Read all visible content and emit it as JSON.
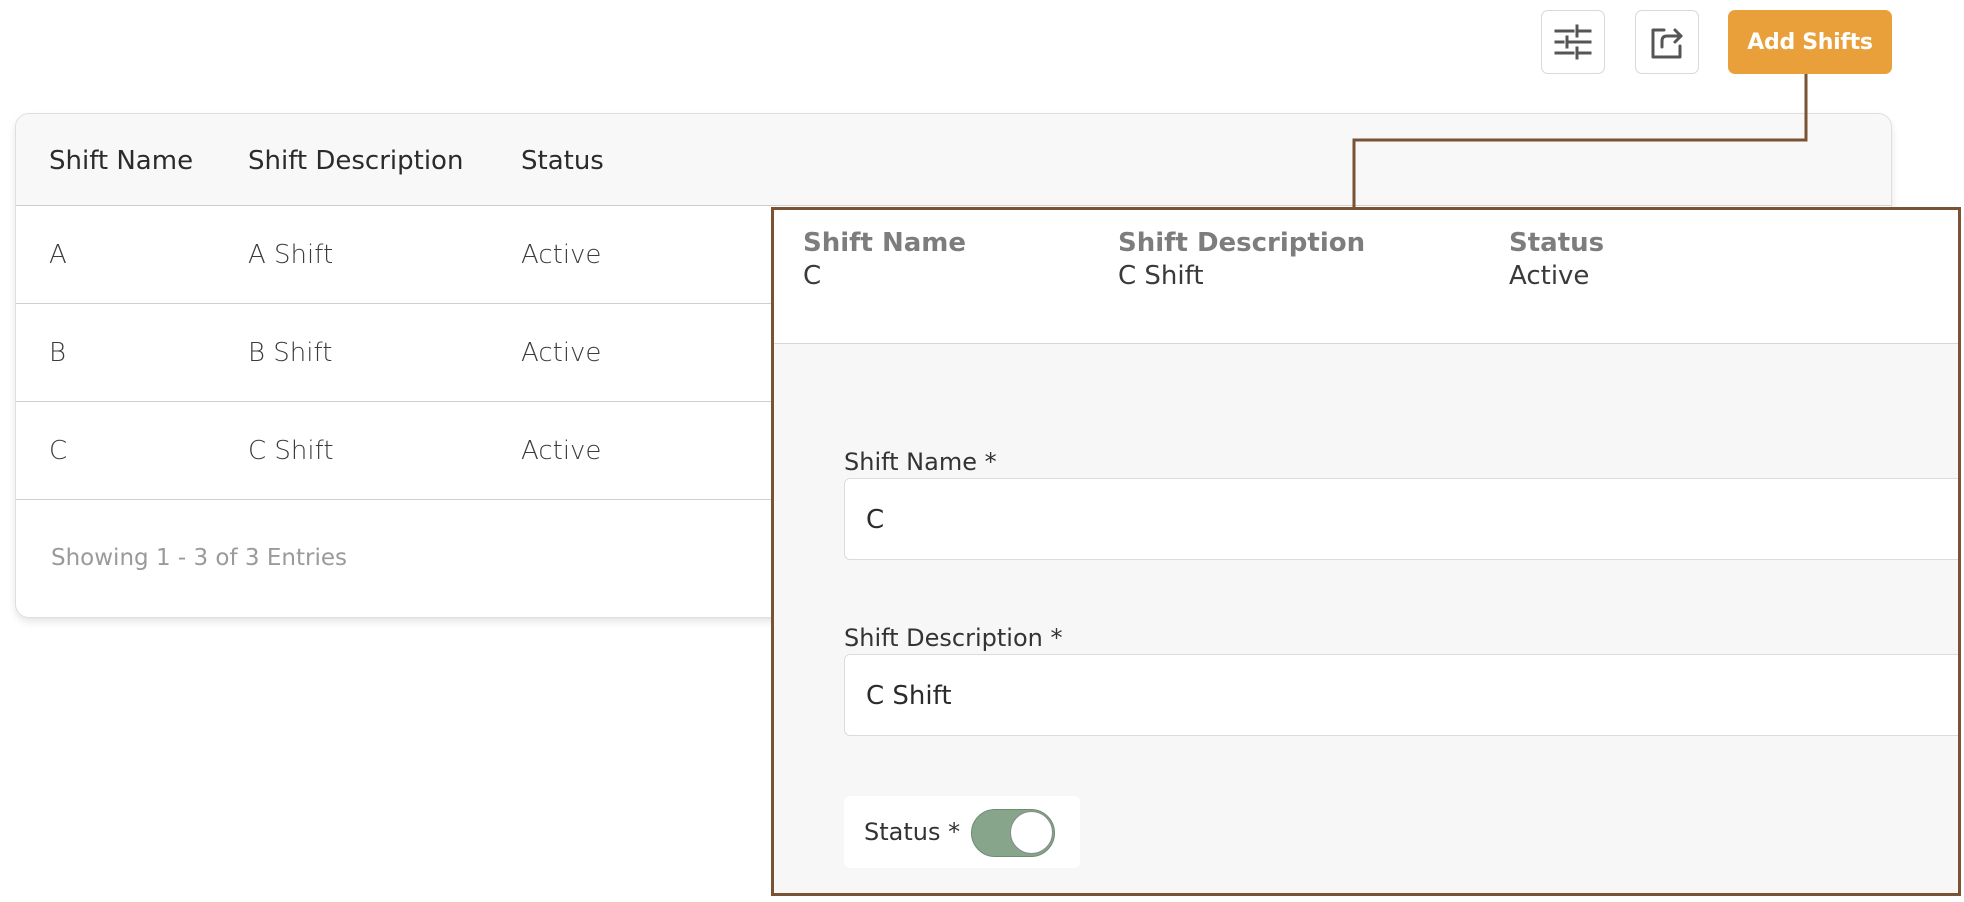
{
  "toolbar": {
    "filter_icon": "sliders-icon",
    "export_icon": "export-icon",
    "add_label": "Add Shifts",
    "accent_color": "#e9a03a"
  },
  "table": {
    "columns": [
      "Shift Name",
      "Shift Description",
      "Status"
    ],
    "rows": [
      {
        "name": "A",
        "description": "A Shift",
        "status": "Active"
      },
      {
        "name": "B",
        "description": "B Shift",
        "status": "Active"
      },
      {
        "name": "C",
        "description": "C Shift",
        "status": "Active"
      }
    ],
    "footer": "Showing 1 - 3 of 3 Entries"
  },
  "detail": {
    "summary": {
      "name_label": "Shift Name",
      "name_value": "C",
      "desc_label": "Shift Description",
      "desc_value": "C Shift",
      "status_label": "Status",
      "status_value": "Active"
    },
    "form": {
      "name_label": "Shift Name *",
      "name_value": "C",
      "desc_label": "Shift Description *",
      "desc_value": "C Shift",
      "status_label": "Status *",
      "status_on": true,
      "toggle_color": "#86a58b"
    },
    "border_color": "#7a5234"
  }
}
